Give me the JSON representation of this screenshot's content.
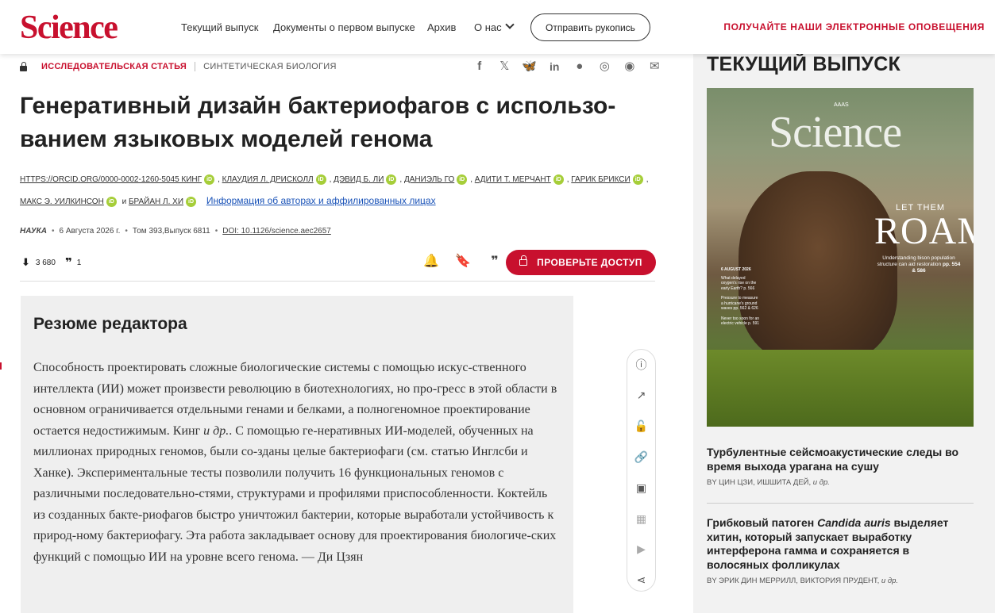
{
  "header": {
    "logo": "Science",
    "nav": [
      "Текущий выпуск",
      "Документы о первом выпуске",
      "Архив",
      "О нас"
    ],
    "submit_label": "Отправить рукопись",
    "alerts_label": "ПОЛУЧАЙТЕ НАШИ ЭЛЕКТРОННЫЕ ОПОВЕЩЕНИЯ"
  },
  "article": {
    "type": "ИССЛЕДОВАТЕЛЬСКАЯ СТАТЬЯ",
    "topic": "СИНТЕТИЧЕСКАЯ БИОЛОГИЯ",
    "title": "Генеративный дизайн бактериофагов с использо-ванием языковых моделей генома",
    "authors_line1": [
      "HTTPS://ORCID.ORG/0000-0002-1260-5045 КИНГ",
      "КЛАУДИЯ Л. ДРИСКОЛЛ",
      "ДЭВИД Б. ЛИ",
      "ДАНИЭЛЬ ГО",
      "АДИТИ Т. МЕРЧАНТ",
      "ГАРИК БРИКСИ"
    ],
    "authors_line2": [
      "МАКС Э. УИЛКИНСОН",
      "БРАЙАН Л. ХИ"
    ],
    "and_text": "и",
    "affiliations_link": "Информация об авторах и аффилированных лицах",
    "journal": "НАУКА",
    "date": "6 Августа 2026 г.",
    "volume": "Том 393,Выпуск 6811",
    "doi": "DOI: 10.1126/science.aec2657",
    "downloads": "3 680",
    "citations": "1",
    "access_label": "ПРОВЕРЬТЕ ДОСТУП"
  },
  "summary": {
    "heading": "Резюме редактора",
    "text_before_italic": "Способность проектировать сложные биологические системы с помощью искус-ственного интеллекта (ИИ) может произвести революцию в биотехнологиях, но про-гресс в этой области в основном ограничивается отдельными генами и белками, а полногеномное проектирование остается недостижимым. Кинг ",
    "italic": "и др.",
    "text_after_italic": ". С помощью ге-неративных ИИ-моделей, обученных на миллионах природных геномов, были со-зданы целые бактериофаги (см. статью Инглсби и Ханке). Экспериментальные тесты позволили получить 16 функциональных геномов с различными последовательно-стями, структурами и профилями приспособленности. Коктейль из созданных бакте-риофагов быстро уничтожил бактерии, которые выработали устойчивость к природ-ному бактериофагу. Эта работа закладывает основу для проектирования биологиче-ских функций с помощью ИИ на уровне всего генома. — Ди Цзян"
  },
  "sidebar": {
    "heading": "ТЕКУЩИЙ ВЫПУСК",
    "cover": {
      "logo": "Science",
      "aaas": "AAAS",
      "let_them": "LET THEM",
      "roam": "ROAM",
      "caption": "Understanding bison population structure can aid restoration",
      "caption_pages": "pp. 554 & 586",
      "date": "6 AUGUST 2026",
      "teasers": [
        "What delayed oxygen's rise on the early Earth? p. 566",
        "Pressure to measure a hurricane's ground waves pp. 562 & 626",
        "Never too soon for an electric vehicle p. 591"
      ]
    },
    "articles": [
      {
        "title": "Турбулентные сейсмоакустические следы во время выхода урагана на сушу",
        "byline": "BY ЦИН ЦЗИ, ИШШИТА ДЕЙ, ",
        "etal": "и др."
      },
      {
        "title_before": "Грибковый патоген ",
        "title_italic": "Candida auris",
        "title_after": " выделяет хитин, который запускает выработку интерферона гамма и сохраняется в волосяных фолликулах",
        "byline": "BY ЭРИК ДИН МЕРРИЛЛ, ВИКТОРИЯ ПРУДЕНТ, ",
        "etal": "и др."
      }
    ]
  },
  "icons": {
    "share": [
      "facebook-icon",
      "x-icon",
      "bluesky-icon",
      "linkedin-icon",
      "reddit-icon",
      "wechat-icon",
      "whatsapp-icon",
      "email-icon"
    ],
    "float": [
      "info-icon",
      "metrics-icon",
      "unlock-icon",
      "link-icon",
      "figures-icon",
      "tables-icon",
      "media-icon",
      "share-icon"
    ]
  },
  "colors": {
    "brand": "#c8102e",
    "link": "#1a53b8",
    "orcid": "#a6ce39",
    "summary_bg": "#efefef",
    "sidebar_bg": "#f2f2f2"
  }
}
